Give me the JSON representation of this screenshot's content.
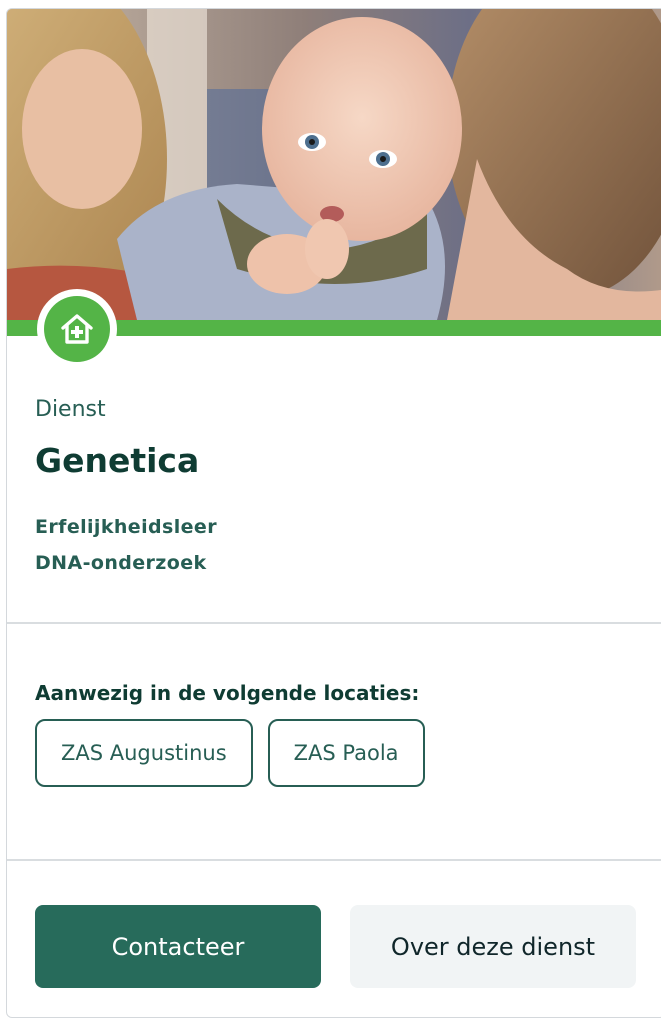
{
  "card": {
    "image_alt": "Baby held by mother",
    "icon": "hospital-house-icon",
    "category": "Dienst",
    "title": "Genetica",
    "subtopics": [
      "Erfelijkheidsleer",
      "DNA-onderzoek"
    ],
    "locations_heading": "Aanwezig in de volgende locaties:",
    "locations": [
      "ZAS Augustinus",
      "ZAS Paola"
    ],
    "actions": {
      "primary_label": "Contacteer",
      "secondary_label": "Over deze dienst"
    }
  },
  "colors": {
    "accent_green": "#54b447",
    "primary_button": "#276b5b",
    "heading_dark": "#0f3c33",
    "text_teal": "#275e54"
  }
}
